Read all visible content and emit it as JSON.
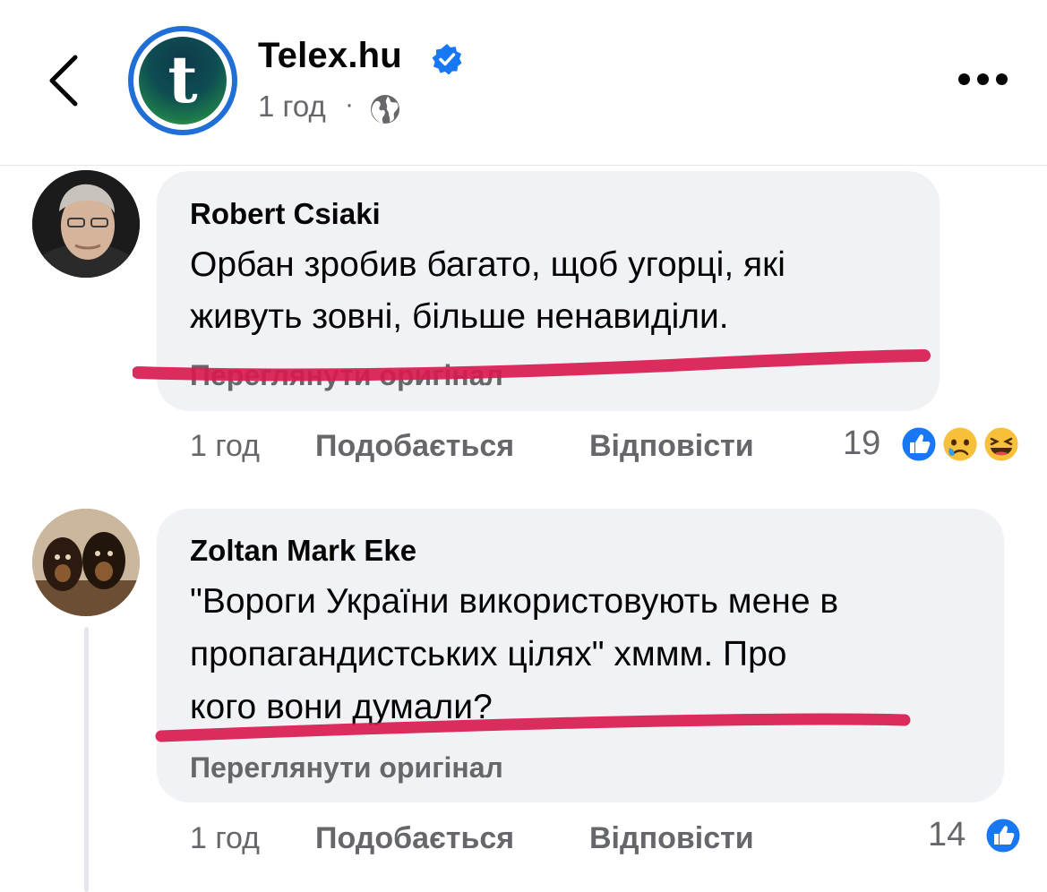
{
  "header": {
    "page_name": "Telex.hu",
    "avatar_letter": "t",
    "post_time": "1 год",
    "separator": "·",
    "icons": [
      "back-chevron-icon",
      "verified-badge-icon",
      "globe-icon",
      "more-icon"
    ]
  },
  "comments": [
    {
      "author": "Robert Csiaki",
      "text_lines": [
        "Орбан зробив багато, щоб угорці, які",
        "живуть зовні, більше ненавиділи."
      ],
      "see_original": "Переглянути оригінал",
      "time": "1 год",
      "like_label": "Подобається",
      "reply_label": "Відповісти",
      "reaction_count": "19",
      "reactions": [
        "like",
        "sad",
        "haha"
      ]
    },
    {
      "author": "Zoltan Mark Eke",
      "text_lines": [
        "\"Вороги України використовують мене в",
        "пропагандистських цілях\" хммм. Про",
        "кого вони думали?"
      ],
      "see_original": "Переглянути оригінал",
      "time": "1 год",
      "like_label": "Подобається",
      "reply_label": "Відповісти",
      "reaction_count": "14",
      "reactions": [
        "like"
      ]
    }
  ],
  "colors": {
    "fb_blue": "#1877f2",
    "bubble_bg": "#f0f2f5",
    "secondary_text": "#65676b",
    "annotation_red": "#d81b4f"
  }
}
